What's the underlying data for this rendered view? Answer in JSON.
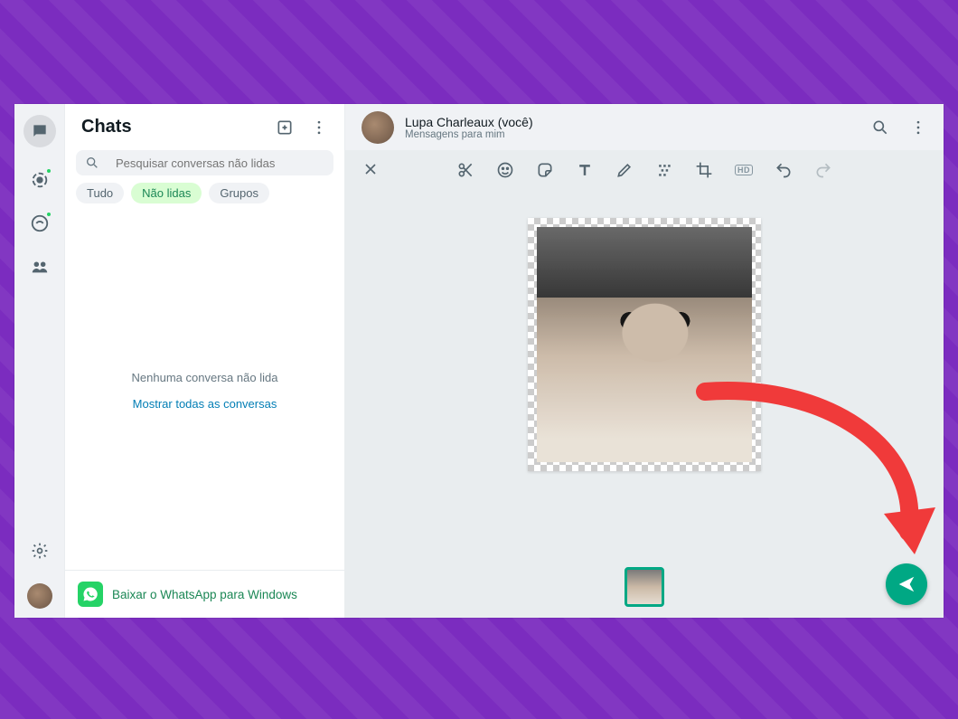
{
  "navrail": {
    "chats_icon": "chat-icon",
    "status_icon": "status-icon",
    "channels_icon": "channels-icon",
    "communities_icon": "communities-icon",
    "settings_icon": "settings-icon"
  },
  "sidebar": {
    "title": "Chats",
    "new_chat_icon": "new-chat-icon",
    "menu_icon": "menu-icon",
    "search_placeholder": "Pesquisar conversas não lidas",
    "filters": {
      "all": "Tudo",
      "unread": "Não lidas",
      "groups": "Grupos"
    },
    "empty_text": "Nenhuma conversa não lida",
    "show_all_text": "Mostrar todas as conversas",
    "download_text": "Baixar o WhatsApp para Windows"
  },
  "chat": {
    "contact_name": "Lupa Charleaux (você)",
    "contact_sub": "Mensagens para mim"
  },
  "editor": {
    "tools": {
      "crop": "scissors-icon",
      "emoji": "emoji-icon",
      "sticker": "sticker-icon",
      "text": "text-icon",
      "draw": "pen-icon",
      "blur": "blur-icon",
      "cropframe": "crop-icon",
      "hd": "HD",
      "undo": "undo-icon",
      "redo": "redo-icon"
    }
  },
  "colors": {
    "accent": "#00a884",
    "annotation": "#f03a3a"
  }
}
